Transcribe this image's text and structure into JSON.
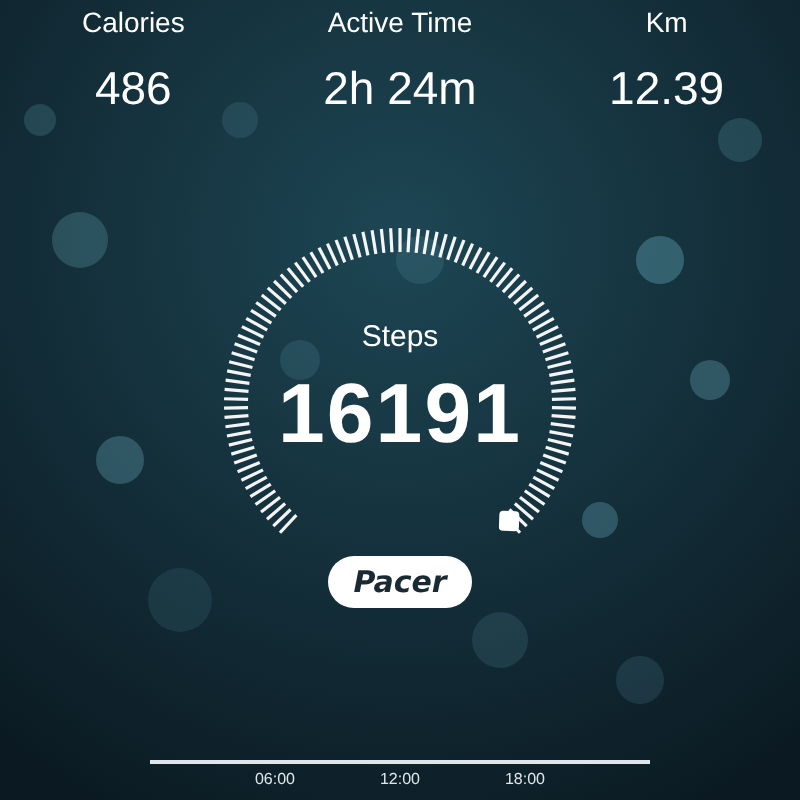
{
  "stats": [
    {
      "label": "Calories",
      "value": "486"
    },
    {
      "label": "Active Time",
      "value": "2h 24m"
    },
    {
      "label": "Km",
      "value": "12.39"
    }
  ],
  "steps": {
    "label": "Steps",
    "value": "16191"
  },
  "brand_button": {
    "label": "Pacer"
  },
  "timeline": {
    "labels": [
      "06:00",
      "12:00",
      "18:00"
    ]
  }
}
